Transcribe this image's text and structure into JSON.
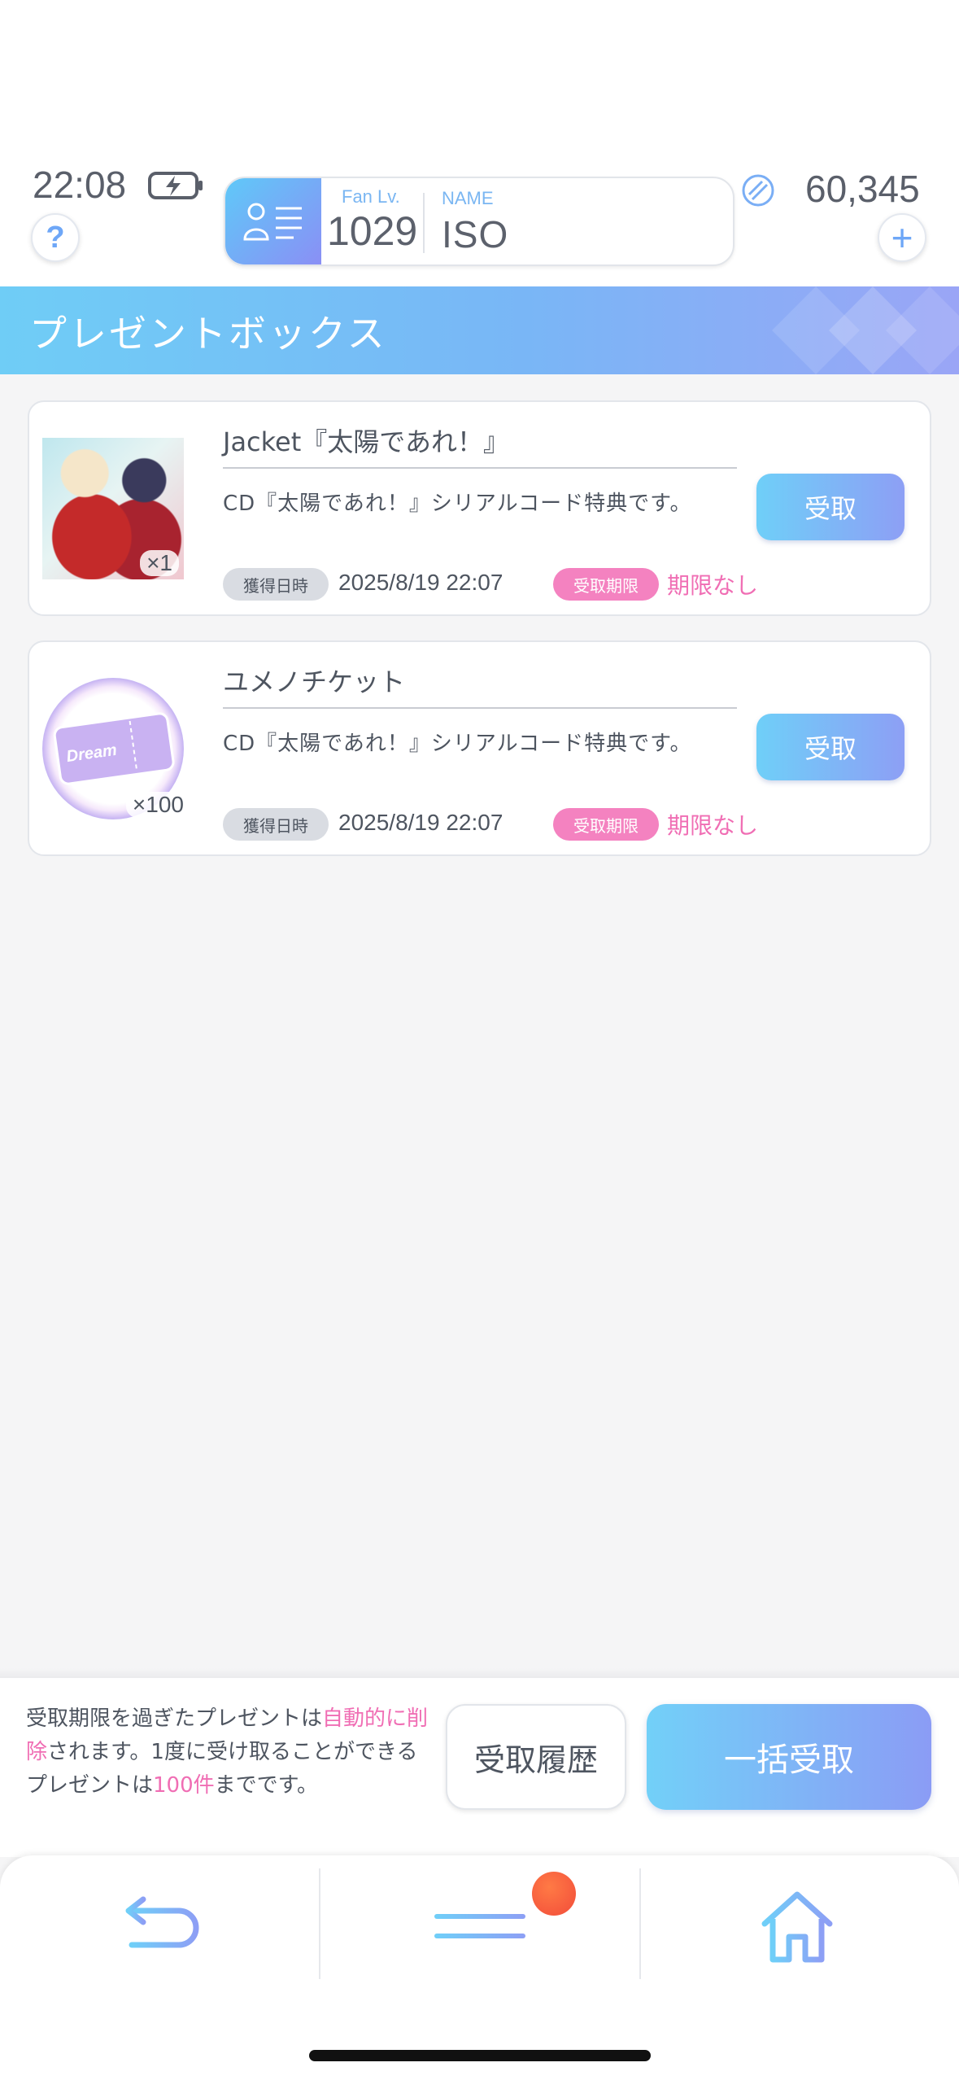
{
  "status_bar": {
    "time": "22:08",
    "battery_icon": "charging-battery-icon"
  },
  "header": {
    "help_icon": "?",
    "fan_lv_label": "Fan Lv.",
    "fan_lv_value": "1029",
    "name_label": "NAME",
    "name_value": "ISO",
    "currency_icon": "gem-icon",
    "currency_value": "60,345",
    "add_icon": "+"
  },
  "page": {
    "title": "プレゼントボックス"
  },
  "presents": [
    {
      "title": "Jacket『太陽であれ！』",
      "description": "CD『太陽であれ！』シリアルコード特典です。",
      "quantity": "×1",
      "receive_label": "受取",
      "acquired_tag": "獲得日時",
      "acquired_date": "2025/8/19 22:07",
      "expiry_tag": "受取期限",
      "expiry_value": "期限なし",
      "thumb_text": ""
    },
    {
      "title": "ユメノチケット",
      "description": "CD『太陽であれ！』シリアルコード特典です。",
      "quantity": "×100",
      "receive_label": "受取",
      "acquired_tag": "獲得日時",
      "acquired_date": "2025/8/19 22:07",
      "expiry_tag": "受取期限",
      "expiry_value": "期限なし",
      "thumb_text": "Dream"
    }
  ],
  "footer": {
    "note_part1": "受取期限を過ぎたプレゼントは",
    "note_highlight1": "自動的に削除",
    "note_part2": "されます。1度に受け取ることができるプレゼントは",
    "note_highlight2": "100件",
    "note_part3": "までです。",
    "history_label": "受取履歴",
    "bulk_label": "一括受取"
  },
  "nav": {
    "back_icon": "back-arrow-icon",
    "menu_icon": "menu-icon",
    "home_icon": "home-icon"
  },
  "colors": {
    "accent_gradient_start": "#6fcff8",
    "accent_gradient_end": "#8d9ff5",
    "pink": "#f06eb4"
  }
}
